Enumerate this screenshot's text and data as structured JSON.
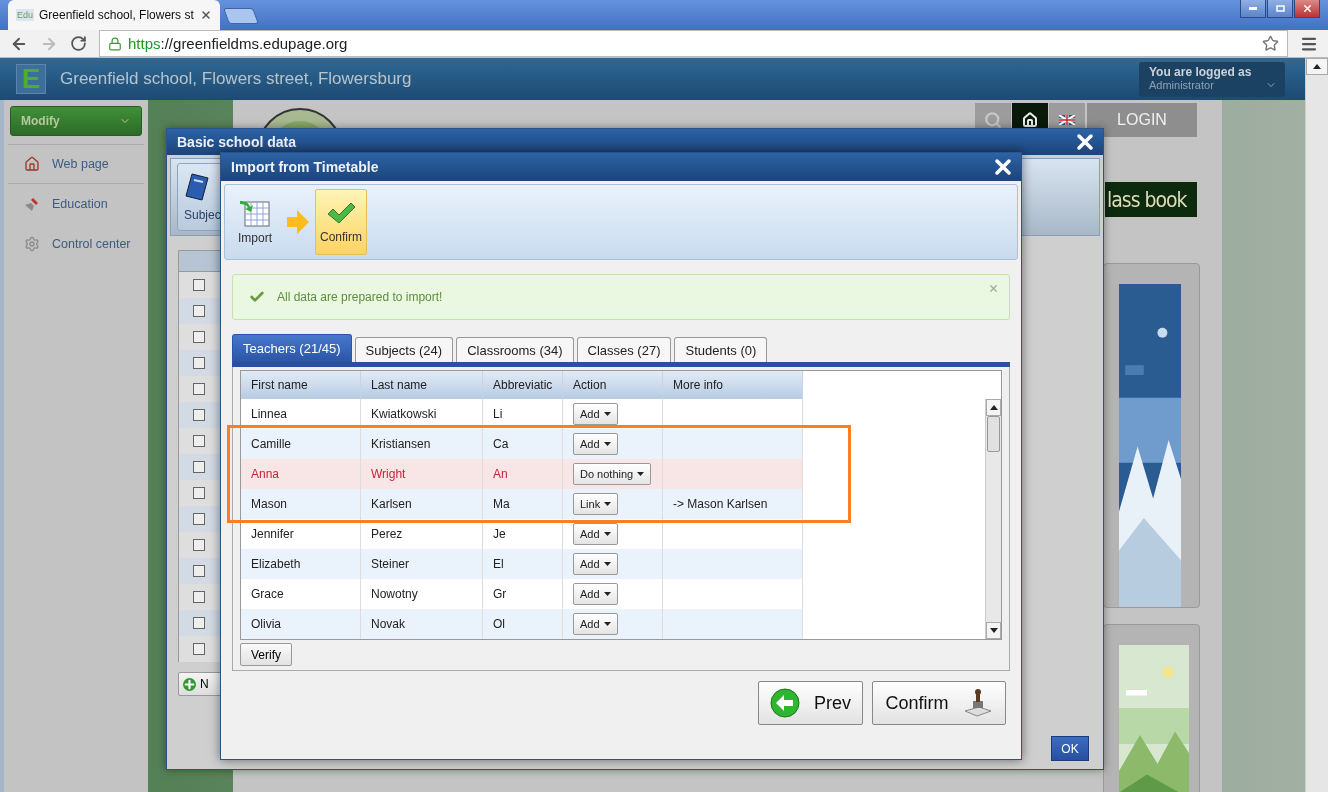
{
  "browser": {
    "tab_favicon": "Edu",
    "tab_title": "Greenfield school, Flowers st",
    "url_scheme": "https",
    "url_rest": "://greenfieldms.edupage.org"
  },
  "site": {
    "logo_letter": "E",
    "title": "Greenfield school, Flowers street, Flowersburg",
    "user_label": "You are logged as",
    "user_role": "Administrator",
    "login": "LOGIN",
    "class_book": "lass book"
  },
  "sidebar": {
    "button": "Modify",
    "items": [
      {
        "label": "Web page",
        "kind": "home"
      },
      {
        "label": "Education",
        "kind": "education"
      },
      {
        "label": "Control center",
        "kind": "settings"
      }
    ]
  },
  "outer_dialog": {
    "title": "Basic school data",
    "toolbar_label": "Subjec",
    "checkboxes": [
      {
        "checked": false
      },
      {
        "checked": false
      },
      {
        "checked": false
      },
      {
        "checked": false
      },
      {
        "checked": false
      },
      {
        "checked": false
      },
      {
        "checked": false
      },
      {
        "checked": false
      },
      {
        "checked": false
      },
      {
        "checked": false
      },
      {
        "checked": false
      },
      {
        "checked": false
      },
      {
        "checked": false
      },
      {
        "checked": false
      },
      {
        "checked": false
      }
    ],
    "new_button": "N",
    "ok": "OK"
  },
  "dialog": {
    "title": "Import from Timetable",
    "steps": [
      {
        "label": "Import",
        "kind": "table",
        "selected": false
      },
      {
        "label": "Confirm",
        "kind": "check",
        "selected": true
      }
    ],
    "alert": "All data are prepared to import!",
    "tabs": [
      {
        "label": "Teachers (21/45)",
        "selected": true
      },
      {
        "label": "Subjects (24)",
        "selected": false
      },
      {
        "label": "Classrooms (34)",
        "selected": false
      },
      {
        "label": "Classes (27)",
        "selected": false
      },
      {
        "label": "Students (0)",
        "selected": false
      }
    ],
    "columns": [
      "First name",
      "Last name",
      "Abbreviatic",
      "Action",
      "More info"
    ],
    "rows": [
      {
        "first": "Linnea",
        "last": "Kwiatkowski",
        "abbr": "Li",
        "action": "Add",
        "warning": false,
        "highlighted": false
      },
      {
        "first": "Camille",
        "last": "Kristiansen",
        "abbr": "Ca",
        "action": "Add",
        "warning": false,
        "highlighted": true
      },
      {
        "first": "Anna",
        "last": "Wright",
        "abbr": "An",
        "action": "Do nothing",
        "warning": true,
        "highlighted": true
      },
      {
        "first": "Mason",
        "last": "Karlsen",
        "abbr": "Ma",
        "action": "Link",
        "more_info": "-> Mason Karlsen",
        "warning": false,
        "highlighted": true
      },
      {
        "first": "Jennifer",
        "last": "Perez",
        "abbr": "Je",
        "action": "Add",
        "warning": false,
        "highlighted": false
      },
      {
        "first": "Elizabeth",
        "last": "Steiner",
        "abbr": "El",
        "action": "Add",
        "warning": false,
        "highlighted": false
      },
      {
        "first": "Grace",
        "last": "Nowotny",
        "abbr": "Gr",
        "action": "Add",
        "warning": false,
        "highlighted": false
      },
      {
        "first": "Olivia",
        "last": "Novak",
        "abbr": "Ol",
        "action": "Add",
        "warning": false,
        "highlighted": false
      }
    ],
    "verify": "Verify",
    "prev": "Prev",
    "confirm": "Confirm"
  }
}
